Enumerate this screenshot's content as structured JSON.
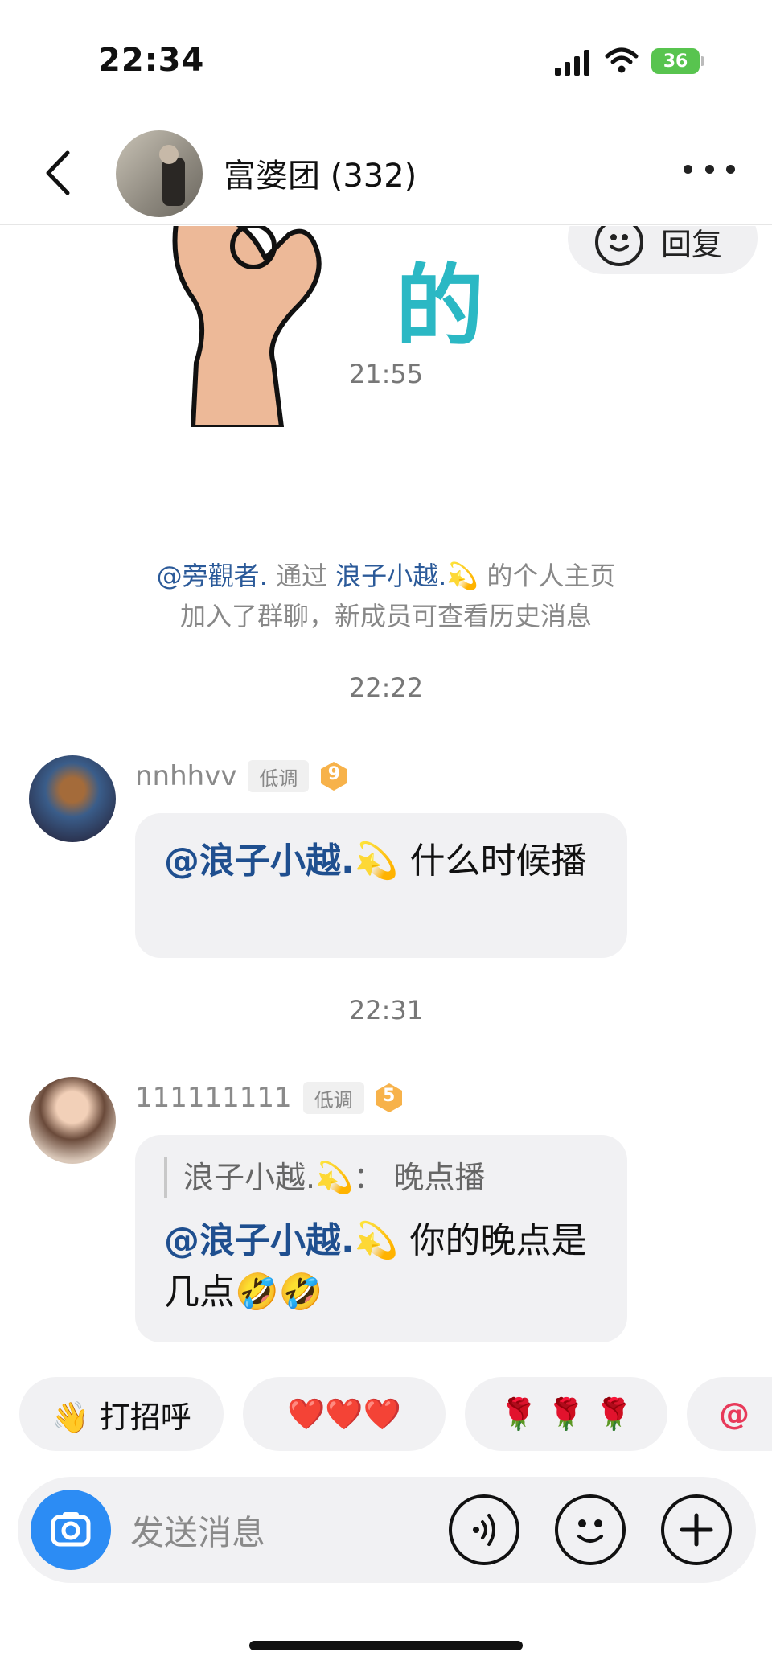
{
  "status_bar": {
    "time": "22:34",
    "battery": "36"
  },
  "header": {
    "title": "富婆团 (332)"
  },
  "sticker_text": "的",
  "reply_chip": {
    "label": "回复"
  },
  "timestamps": [
    "21:55",
    "22:22",
    "22:31"
  ],
  "system_message": {
    "user": "@旁觀者.",
    "via": "通过",
    "inviter": "浪子小越.💫",
    "suffix": "的个人主页",
    "line2": "加入了群聊，新成员可查看历史消息"
  },
  "messages": [
    {
      "sender": "nnhhvv",
      "role": "低调",
      "level": "9",
      "mention": "@浪子小越.💫",
      "text": "什么时候播"
    },
    {
      "sender": "111111111",
      "role": "低调",
      "level": "5",
      "quote": "浪子小越.💫：  晚点播",
      "mention": "@浪子小越.💫",
      "text": "你的晚点是几点🤣🤣"
    }
  ],
  "quick_replies": [
    {
      "label": "👋 打招呼"
    },
    {
      "label": "❤️❤️❤️"
    },
    {
      "label": "🌹 🌹 🌹"
    },
    {
      "label": "@"
    }
  ],
  "input": {
    "placeholder": "发送消息"
  },
  "colors": {
    "mention": "#1f4f8f",
    "camera": "#2c8cf4",
    "battery": "#58c44f"
  }
}
